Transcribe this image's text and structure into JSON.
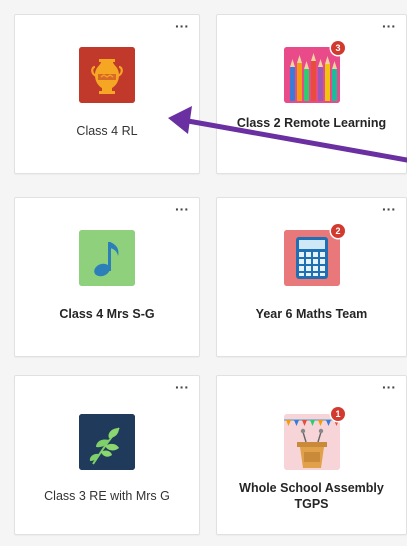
{
  "teams": [
    {
      "name": "Class 4 RL",
      "badge": "",
      "more": "···",
      "icon": "amphora-icon",
      "color": "#c0392b"
    },
    {
      "name": "Class 2 Remote Learning",
      "badge": "3",
      "more": "···",
      "icon": "pencils-icon",
      "color": "#e84a8a"
    },
    {
      "name": "Class 4 Mrs S-G",
      "badge": "",
      "more": "···",
      "icon": "music-note-icon",
      "color": "#8fd07c"
    },
    {
      "name": "Year 6 Maths Team",
      "badge": "2",
      "more": "···",
      "icon": "calculator-icon",
      "color": "#e9787b"
    },
    {
      "name": "Class 3 RE with Mrs G",
      "badge": "",
      "more": "···",
      "icon": "leaves-icon",
      "color": "#1f3a5a"
    },
    {
      "name": "Whole School Assembly TGPS",
      "badge": "1",
      "more": "···",
      "icon": "podium-icon",
      "color": "#f6d4d7"
    }
  ],
  "colors": {
    "arrow": "#6a2fa0",
    "badge": "#d23a2f"
  }
}
